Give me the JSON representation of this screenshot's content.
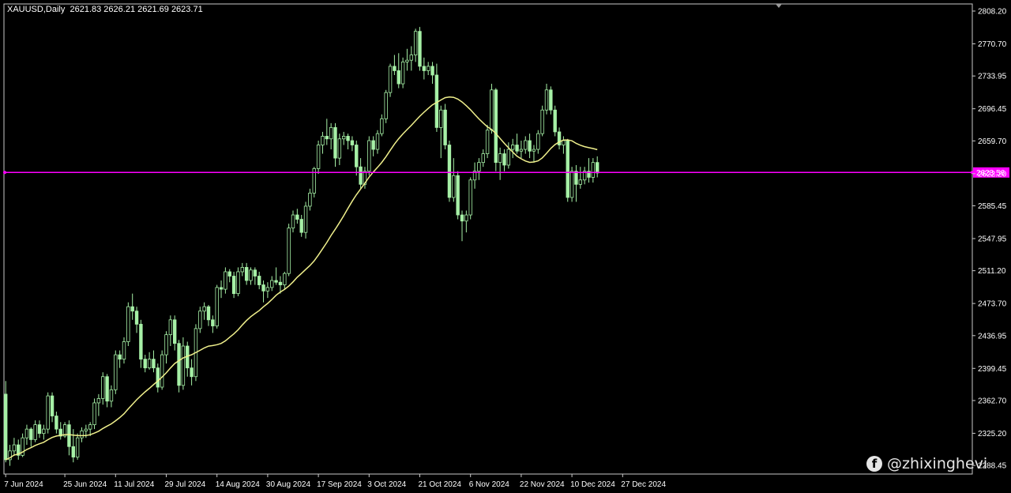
{
  "header": {
    "symbol": "XAUUSD,Daily",
    "ohlc": "2621.83 2626.21 2621.69 2623.71"
  },
  "watermark": {
    "icon": "facebook-icon",
    "handle": "@zhixinghevi"
  },
  "colors": {
    "background": "#000000",
    "candle": "#a6f0a6",
    "moving_average": "#f0f08c",
    "price_line": "#ff00ff",
    "frame": "#c8c8c8"
  },
  "chart_data": {
    "type": "candlestick",
    "title": "XAUUSD,Daily",
    "ylim": [
      2289.45,
      2808.2
    ],
    "y_ticks": [
      "2808.20",
      "2770.70",
      "2733.95",
      "2696.45",
      "2659.70",
      "2622.20",
      "2585.45",
      "2547.95",
      "2511.20",
      "2473.70",
      "2436.95",
      "2399.45",
      "2362.70",
      "2325.20",
      "2288.45"
    ],
    "x_ticks": [
      {
        "index": 0,
        "label": "7 Jun 2024"
      },
      {
        "index": 14,
        "label": "25 Jun 2024"
      },
      {
        "index": 26,
        "label": "11 Jul 2024"
      },
      {
        "index": 38,
        "label": "29 Jul 2024"
      },
      {
        "index": 50,
        "label": "14 Aug 2024"
      },
      {
        "index": 62,
        "label": "30 Aug 2024"
      },
      {
        "index": 74,
        "label": "17 Sep 2024"
      },
      {
        "index": 86,
        "label": "3 Oct 2024"
      },
      {
        "index": 98,
        "label": "21 Oct 2024"
      },
      {
        "index": 110,
        "label": "6 Nov 2024"
      },
      {
        "index": 122,
        "label": "22 Nov 2024"
      },
      {
        "index": 134,
        "label": "10 Dec 2024"
      },
      {
        "index": 146,
        "label": "27 Dec 2024"
      }
    ],
    "current_price": 2623.56,
    "current_price_label": "2623.56",
    "ohlc": [
      [
        2370,
        2385,
        2292,
        2295
      ],
      [
        2295,
        2312,
        2288,
        2305
      ],
      [
        2305,
        2320,
        2300,
        2312
      ],
      [
        2312,
        2318,
        2295,
        2300
      ],
      [
        2300,
        2325,
        2298,
        2320
      ],
      [
        2320,
        2335,
        2312,
        2330
      ],
      [
        2330,
        2332,
        2310,
        2318
      ],
      [
        2318,
        2340,
        2315,
        2335
      ],
      [
        2335,
        2340,
        2320,
        2325
      ],
      [
        2325,
        2335,
        2318,
        2330
      ],
      [
        2330,
        2372,
        2325,
        2368
      ],
      [
        2368,
        2372,
        2338,
        2345
      ],
      [
        2345,
        2350,
        2325,
        2330
      ],
      [
        2330,
        2338,
        2318,
        2322
      ],
      [
        2322,
        2338,
        2320,
        2335
      ],
      [
        2335,
        2340,
        2300,
        2310
      ],
      [
        2310,
        2330,
        2292,
        2298
      ],
      [
        2298,
        2325,
        2295,
        2320
      ],
      [
        2320,
        2332,
        2315,
        2328
      ],
      [
        2328,
        2335,
        2320,
        2330
      ],
      [
        2330,
        2338,
        2322,
        2335
      ],
      [
        2335,
        2365,
        2330,
        2360
      ],
      [
        2360,
        2370,
        2345,
        2365
      ],
      [
        2365,
        2395,
        2358,
        2390
      ],
      [
        2390,
        2393,
        2355,
        2362
      ],
      [
        2362,
        2380,
        2355,
        2375
      ],
      [
        2375,
        2420,
        2370,
        2415
      ],
      [
        2415,
        2420,
        2400,
        2410
      ],
      [
        2410,
        2435,
        2405,
        2430
      ],
      [
        2430,
        2475,
        2425,
        2470
      ],
      [
        2470,
        2485,
        2455,
        2465
      ],
      [
        2465,
        2470,
        2440,
        2450
      ],
      [
        2450,
        2455,
        2400,
        2410
      ],
      [
        2410,
        2415,
        2395,
        2400
      ],
      [
        2400,
        2418,
        2398,
        2410
      ],
      [
        2410,
        2420,
        2395,
        2400
      ],
      [
        2400,
        2405,
        2372,
        2378
      ],
      [
        2378,
        2420,
        2375,
        2415
      ],
      [
        2415,
        2442,
        2405,
        2438
      ],
      [
        2438,
        2460,
        2425,
        2455
      ],
      [
        2455,
        2460,
        2420,
        2428
      ],
      [
        2428,
        2432,
        2372,
        2380
      ],
      [
        2380,
        2435,
        2375,
        2425
      ],
      [
        2425,
        2430,
        2390,
        2400
      ],
      [
        2400,
        2410,
        2380,
        2390
      ],
      [
        2390,
        2450,
        2385,
        2445
      ],
      [
        2445,
        2470,
        2440,
        2465
      ],
      [
        2465,
        2475,
        2455,
        2470
      ],
      [
        2470,
        2472,
        2448,
        2455
      ],
      [
        2455,
        2460,
        2440,
        2448
      ],
      [
        2448,
        2495,
        2445,
        2492
      ],
      [
        2492,
        2500,
        2480,
        2490
      ],
      [
        2490,
        2515,
        2485,
        2510
      ],
      [
        2510,
        2513,
        2498,
        2505
      ],
      [
        2505,
        2510,
        2480,
        2485
      ],
      [
        2485,
        2515,
        2482,
        2510
      ],
      [
        2510,
        2520,
        2505,
        2515
      ],
      [
        2515,
        2520,
        2495,
        2500
      ],
      [
        2500,
        2515,
        2495,
        2512
      ],
      [
        2512,
        2515,
        2495,
        2505
      ],
      [
        2505,
        2510,
        2490,
        2495
      ],
      [
        2495,
        2500,
        2475,
        2488
      ],
      [
        2488,
        2498,
        2480,
        2492
      ],
      [
        2492,
        2505,
        2488,
        2500
      ],
      [
        2500,
        2515,
        2495,
        2498
      ],
      [
        2498,
        2505,
        2485,
        2495
      ],
      [
        2495,
        2510,
        2490,
        2508
      ],
      [
        2508,
        2565,
        2505,
        2560
      ],
      [
        2560,
        2580,
        2555,
        2575
      ],
      [
        2575,
        2582,
        2565,
        2570
      ],
      [
        2570,
        2575,
        2550,
        2555
      ],
      [
        2555,
        2590,
        2548,
        2585
      ],
      [
        2585,
        2605,
        2580,
        2600
      ],
      [
        2600,
        2630,
        2595,
        2628
      ],
      [
        2628,
        2660,
        2622,
        2655
      ],
      [
        2655,
        2670,
        2645,
        2665
      ],
      [
        2665,
        2685,
        2655,
        2662
      ],
      [
        2662,
        2680,
        2650,
        2675
      ],
      [
        2675,
        2680,
        2630,
        2640
      ],
      [
        2640,
        2668,
        2632,
        2662
      ],
      [
        2662,
        2670,
        2655,
        2665
      ],
      [
        2665,
        2668,
        2650,
        2660
      ],
      [
        2660,
        2665,
        2648,
        2655
      ],
      [
        2655,
        2660,
        2620,
        2630
      ],
      [
        2630,
        2640,
        2605,
        2610
      ],
      [
        2610,
        2630,
        2605,
        2625
      ],
      [
        2625,
        2665,
        2620,
        2660
      ],
      [
        2660,
        2665,
        2642,
        2650
      ],
      [
        2650,
        2672,
        2645,
        2668
      ],
      [
        2668,
        2690,
        2665,
        2685
      ],
      [
        2685,
        2718,
        2680,
        2715
      ],
      [
        2715,
        2748,
        2710,
        2745
      ],
      [
        2745,
        2758,
        2735,
        2740
      ],
      [
        2740,
        2760,
        2720,
        2725
      ],
      [
        2725,
        2755,
        2720,
        2750
      ],
      [
        2750,
        2765,
        2740,
        2752
      ],
      [
        2752,
        2768,
        2740,
        2758
      ],
      [
        2758,
        2788,
        2750,
        2785
      ],
      [
        2785,
        2790,
        2740,
        2745
      ],
      [
        2745,
        2755,
        2730,
        2740
      ],
      [
        2740,
        2750,
        2735,
        2745
      ],
      [
        2745,
        2750,
        2725,
        2735
      ],
      [
        2735,
        2748,
        2670,
        2675
      ],
      [
        2675,
        2700,
        2640,
        2695
      ],
      [
        2695,
        2702,
        2650,
        2655
      ],
      [
        2655,
        2660,
        2590,
        2595
      ],
      [
        2595,
        2640,
        2590,
        2620
      ],
      [
        2620,
        2625,
        2570,
        2575
      ],
      [
        2575,
        2580,
        2545,
        2568
      ],
      [
        2568,
        2580,
        2555,
        2575
      ],
      [
        2575,
        2618,
        2570,
        2615
      ],
      [
        2615,
        2635,
        2605,
        2625
      ],
      [
        2625,
        2640,
        2615,
        2635
      ],
      [
        2635,
        2650,
        2630,
        2645
      ],
      [
        2645,
        2678,
        2640,
        2672
      ],
      [
        2672,
        2725,
        2668,
        2718
      ],
      [
        2718,
        2720,
        2625,
        2635
      ],
      [
        2635,
        2652,
        2615,
        2645
      ],
      [
        2645,
        2650,
        2625,
        2632
      ],
      [
        2632,
        2658,
        2628,
        2650
      ],
      [
        2650,
        2662,
        2640,
        2655
      ],
      [
        2655,
        2668,
        2645,
        2648
      ],
      [
        2648,
        2660,
        2640,
        2650
      ],
      [
        2650,
        2665,
        2645,
        2660
      ],
      [
        2660,
        2668,
        2640,
        2648
      ],
      [
        2648,
        2655,
        2635,
        2650
      ],
      [
        2650,
        2672,
        2645,
        2668
      ],
      [
        2668,
        2700,
        2665,
        2695
      ],
      [
        2695,
        2725,
        2690,
        2718
      ],
      [
        2718,
        2722,
        2690,
        2695
      ],
      [
        2695,
        2700,
        2665,
        2670
      ],
      [
        2670,
        2675,
        2650,
        2655
      ],
      [
        2655,
        2665,
        2645,
        2660
      ],
      [
        2660,
        2662,
        2590,
        2595
      ],
      [
        2595,
        2630,
        2590,
        2625
      ],
      [
        2625,
        2632,
        2590,
        2610
      ],
      [
        2610,
        2630,
        2605,
        2615
      ],
      [
        2615,
        2630,
        2610,
        2625
      ],
      [
        2625,
        2640,
        2612,
        2618
      ],
      [
        2618,
        2640,
        2612,
        2635
      ],
      [
        2635,
        2642,
        2618,
        2623
      ]
    ]
  }
}
